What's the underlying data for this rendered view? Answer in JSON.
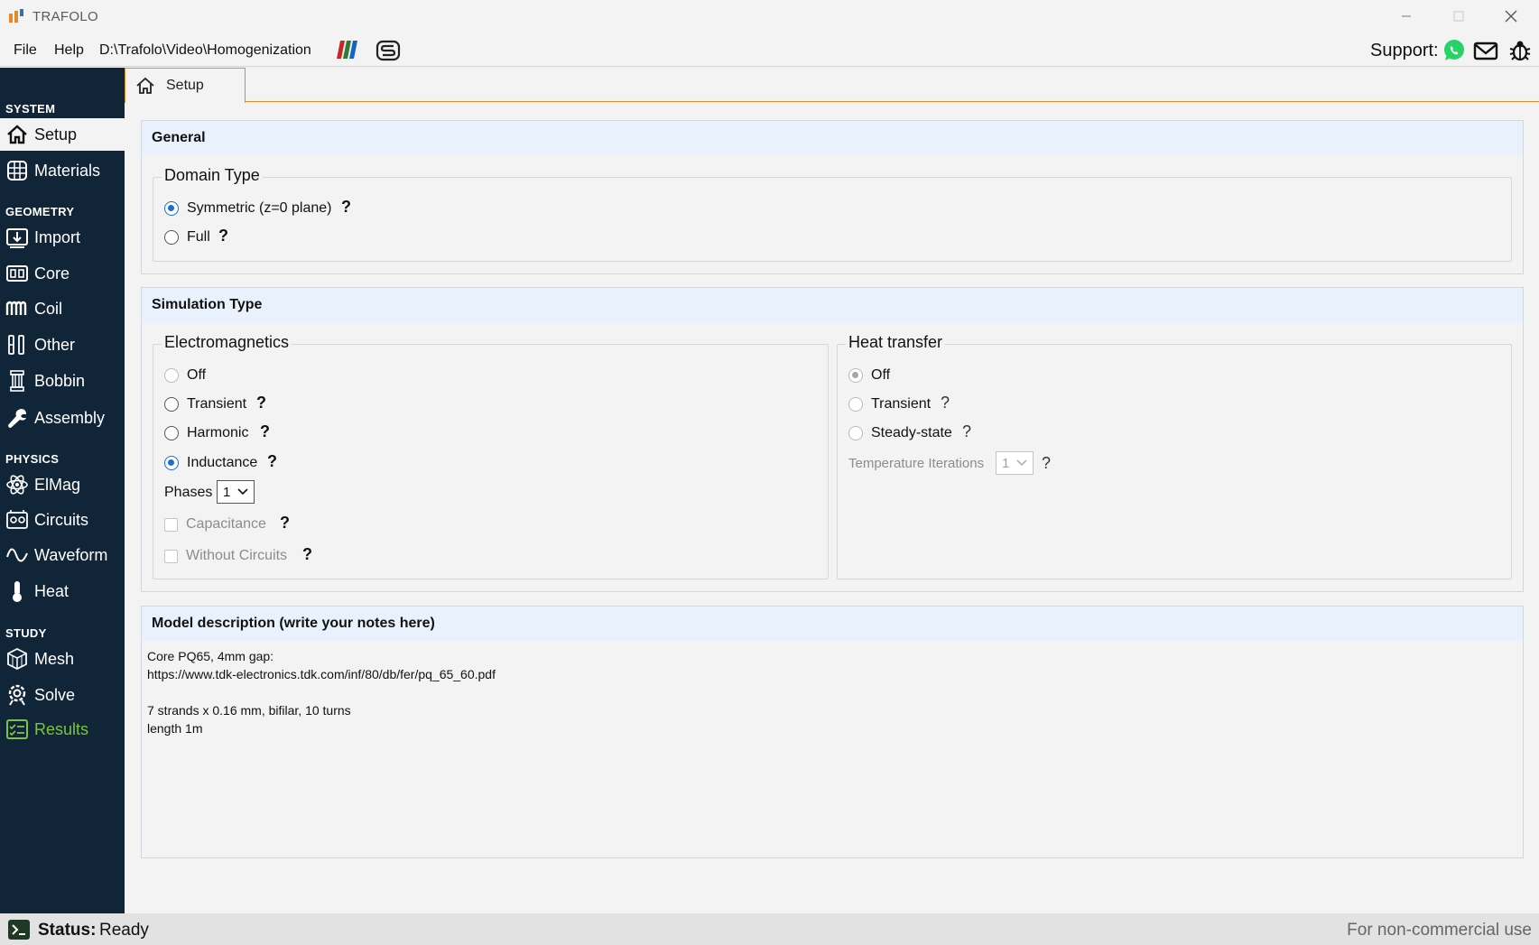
{
  "window": {
    "title": "TRAFOLO"
  },
  "menu": {
    "file": "File",
    "help": "Help",
    "path": "D:\\Trafolo\\Video\\Homogenization"
  },
  "support": {
    "label": "Support:"
  },
  "sidebar": {
    "sections": {
      "system": "SYSTEM",
      "geometry": "GEOMETRY",
      "physics": "PHYSICS",
      "study": "STUDY"
    },
    "items": {
      "setup": "Setup",
      "materials": "Materials",
      "import": "Import",
      "core": "Core",
      "coil": "Coil",
      "other": "Other",
      "bobbin": "Bobbin",
      "assembly": "Assembly",
      "elmag": "ElMag",
      "circuits": "Circuits",
      "waveform": "Waveform",
      "heat": "Heat",
      "mesh": "Mesh",
      "solve": "Solve",
      "results": "Results"
    },
    "active": "setup"
  },
  "tabs": {
    "setup": "Setup"
  },
  "general": {
    "title": "General",
    "domain_type": {
      "title": "Domain Type",
      "options": {
        "symmetric": "Symmetric (z=0 plane)",
        "full": "Full"
      },
      "selected": "symmetric"
    }
  },
  "simulation": {
    "title": "Simulation Type",
    "em": {
      "title": "Electromagnetics",
      "options": {
        "off": "Off",
        "transient": "Transient",
        "harmonic": "Harmonic",
        "inductance": "Inductance"
      },
      "selected": "inductance",
      "phases_label": "Phases",
      "phases_value": "1",
      "capacitance": "Capacitance",
      "without_circuits": "Without Circuits"
    },
    "heat": {
      "title": "Heat transfer",
      "options": {
        "off": "Off",
        "transient": "Transient",
        "steady": "Steady-state"
      },
      "selected": "off",
      "temp_iter_label": "Temperature Iterations",
      "temp_iter_value": "1"
    }
  },
  "help_mark": "?",
  "notes": {
    "title": "Model description (write your notes here)",
    "text": "Core PQ65, 4mm gap:\nhttps://www.tdk-electronics.tdk.com/inf/80/db/fer/pq_65_60.pdf\n\n7 strands x 0.16 mm, bifilar, 10 turns\nlength 1m"
  },
  "status": {
    "label": "Status:",
    "value": "Ready",
    "license": "For non-commercial use"
  },
  "colors": {
    "sidebar_bg": "#112538",
    "accent_orange": "#e58a2b",
    "radio_blue": "#1a6fd1",
    "results_green": "#7fc241",
    "panel_header": "#e9f2fc"
  }
}
